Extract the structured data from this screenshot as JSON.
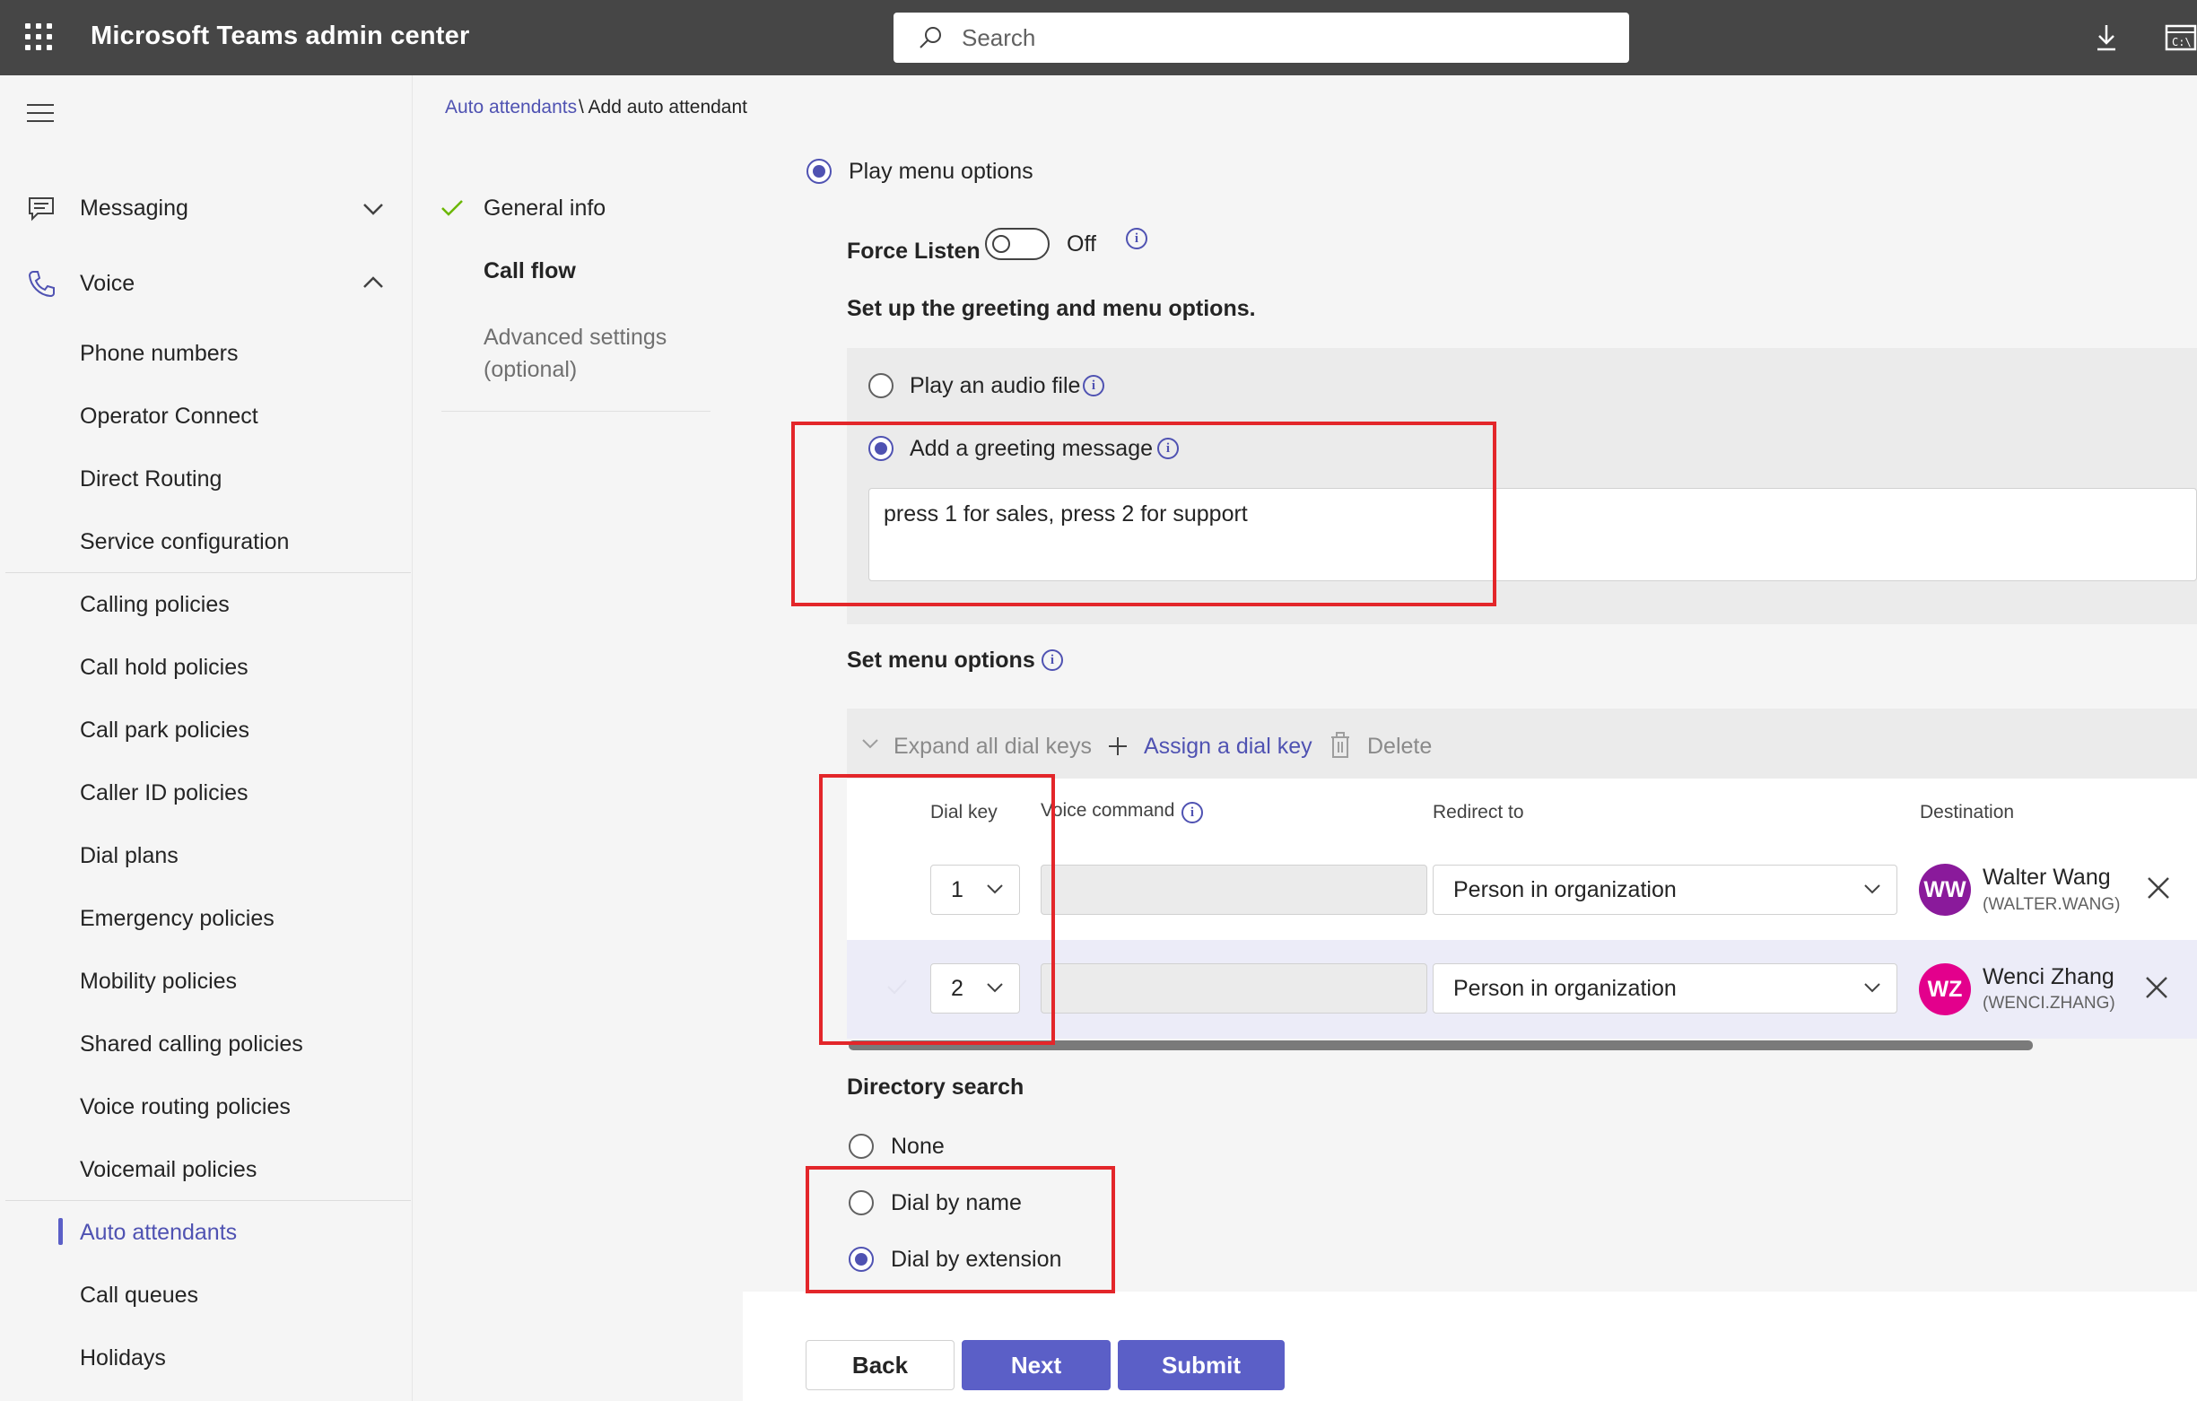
{
  "app": {
    "title": "Microsoft Teams admin center"
  },
  "search": {
    "placeholder": "Search"
  },
  "nav": {
    "messaging": "Messaging",
    "voice": "Voice",
    "items": [
      "Phone numbers",
      "Operator Connect",
      "Direct Routing",
      "Service configuration",
      "Calling policies",
      "Call hold policies",
      "Call park policies",
      "Caller ID policies",
      "Dial plans",
      "Emergency policies",
      "Mobility policies",
      "Shared calling policies",
      "Voice routing policies",
      "Voicemail policies",
      "Auto attendants",
      "Call queues",
      "Holidays"
    ],
    "active": "Auto attendants"
  },
  "breadcrumb": {
    "link": "Auto attendants",
    "rest": "\\ Add auto attendant"
  },
  "steps": {
    "general": "General info",
    "callflow": "Call flow",
    "advanced_line1": "Advanced settings",
    "advanced_line2": "(optional)"
  },
  "callflow": {
    "play_menu_options": "Play menu options",
    "force_listen_label": "Force Listen",
    "force_listen_state": "Off",
    "greeting_heading": "Set up the greeting and menu options.",
    "play_audio_file": "Play an audio file",
    "add_greeting_message": "Add a greeting message",
    "greeting_message": "press 1 for sales, press 2 for support",
    "set_menu_options": "Set menu options"
  },
  "toolbar": {
    "expand_all": "Expand all dial keys",
    "assign": "Assign a dial key",
    "delete": "Delete"
  },
  "table": {
    "headers": {
      "dial_key": "Dial key",
      "voice_command": "Voice command",
      "redirect_to": "Redirect to",
      "destination": "Destination"
    },
    "rows": [
      {
        "key": "1",
        "redirect": "Person in organization",
        "initials": "WW",
        "name": "Walter Wang",
        "username": "(WALTER.WANG)",
        "avatar_color": "#8a1a9b"
      },
      {
        "key": "2",
        "redirect": "Person in organization",
        "initials": "WZ",
        "name": "Wenci Zhang",
        "username": "(WENCI.ZHANG)",
        "avatar_color": "#e3008c"
      }
    ]
  },
  "directory": {
    "heading": "Directory search",
    "none": "None",
    "by_name": "Dial by name",
    "by_extension": "Dial by extension",
    "selected": "Dial by extension"
  },
  "buttons": {
    "back": "Back",
    "next": "Next",
    "submit": "Submit"
  },
  "colors": {
    "accent": "#5b5fc7",
    "annotation": "#e3262a",
    "topbar": "#464646"
  }
}
